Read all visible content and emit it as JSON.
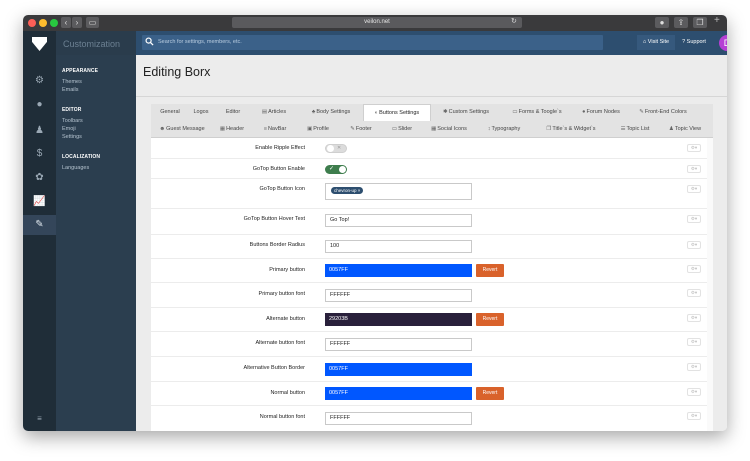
{
  "browser": {
    "url": "veilon.net"
  },
  "sidebar": {
    "brand": "Customization",
    "sections": [
      {
        "title": "APPEARANCE",
        "items": [
          "Themes",
          "Emails"
        ]
      },
      {
        "title": "EDITOR",
        "items": [
          "Toolbars",
          "Emoji",
          "Settings"
        ]
      },
      {
        "title": "LOCALIZATION",
        "items": [
          "Languages"
        ]
      }
    ]
  },
  "topbar": {
    "search_placeholder": "Search for settings, members, etc.",
    "visit_site": "Visit Site",
    "support": "Support",
    "avatar_letter": "D"
  },
  "page": {
    "title": "Editing Borx"
  },
  "tabs": {
    "row1": [
      "General",
      "Logos",
      "Editor",
      "Articles",
      "Body Settings",
      "Buttons Settings",
      "Custom Settings",
      "Forms & Toogle`s",
      "Forum Nodes",
      "Front-End Colors"
    ],
    "row2": [
      "Guest Message",
      "Header",
      "NavBar",
      "Profile",
      "Footer",
      "Slider",
      "Social Icons",
      "Typography",
      "Title`s & Widget`s",
      "Topic List",
      "Topic View"
    ]
  },
  "settings": [
    {
      "label": "Enable Ripple Effect"
    },
    {
      "label": "GoTop Button Enable"
    },
    {
      "label": "GoTop Button Icon",
      "tag": "chevron-up ×"
    },
    {
      "label": "GoTop Button Hover Text",
      "value": "Go Top!"
    },
    {
      "label": "Buttons Border Radius",
      "value": "100"
    },
    {
      "label": "Primary button",
      "value": "0057FF"
    },
    {
      "label": "Primary button font",
      "value": "FFFFFF"
    },
    {
      "label": "Alternate button",
      "value": "29203B"
    },
    {
      "label": "Alternate button font",
      "value": "FFFFFF"
    },
    {
      "label": "Alternative Button Border",
      "value": "0057FF"
    },
    {
      "label": "Normal button",
      "value": "0057FF"
    },
    {
      "label": "Normal button font",
      "value": "FFFFFF"
    }
  ],
  "revert_label": "Revert",
  "gear_label": "⚙▾",
  "colors": {
    "primary_button": "#0057FF",
    "alternate_button": "#29203B",
    "revert": "#D9622B",
    "topbar": "#2D4E6F",
    "toggle_on": "#3E7D4D"
  }
}
